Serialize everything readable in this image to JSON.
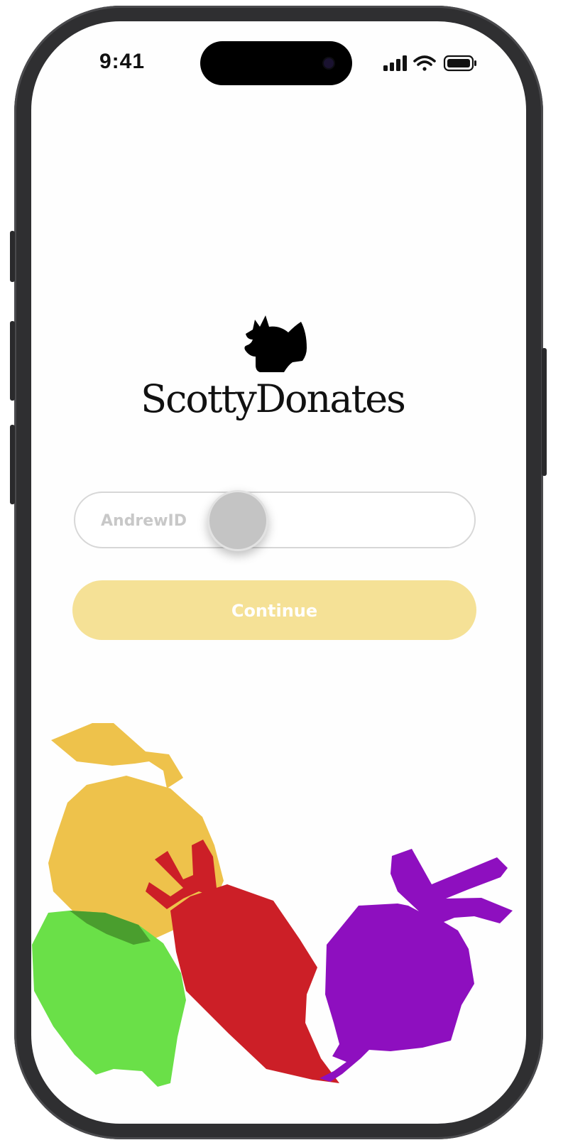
{
  "status_bar": {
    "time": "9:41",
    "icons": [
      "cellular-signal-icon",
      "wifi-icon",
      "battery-icon"
    ]
  },
  "brand": {
    "logo_icon": "scottie-dog-icon",
    "name": "ScottyDonates"
  },
  "login": {
    "andrewid_placeholder": "AndrewID",
    "andrewid_value": "",
    "continue_label": "Continue"
  },
  "colors": {
    "continue_button": "#f5e196",
    "illustration_yellow": "#eec24b",
    "illustration_green": "#6ae048",
    "illustration_red": "#cc1f27",
    "illustration_purple": "#8e0fbf"
  }
}
